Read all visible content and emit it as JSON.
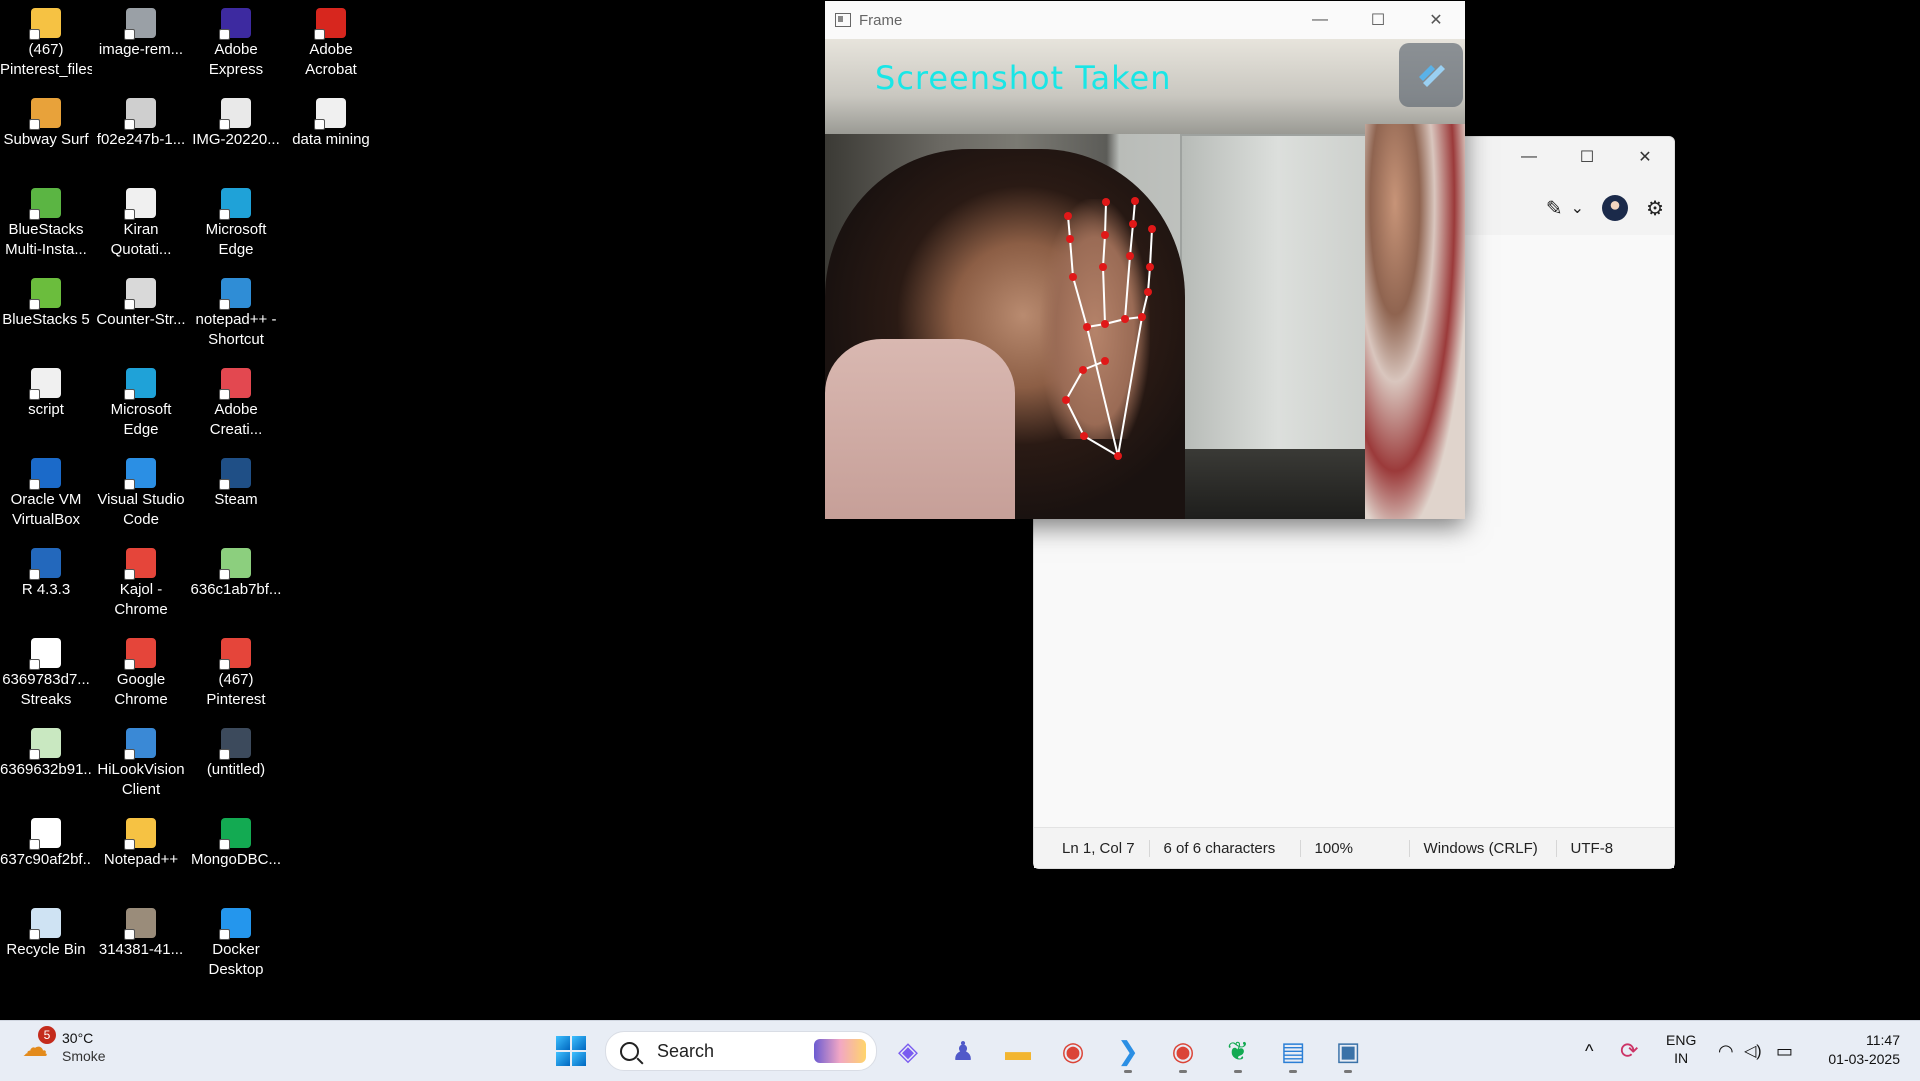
{
  "desktop": {
    "icons": [
      {
        "label": "(467)\nPinterest_files",
        "icon": "folder-icon",
        "color": "#f6c243"
      },
      {
        "label": "image-rem...",
        "icon": "python-file-icon",
        "color": "#9aa0a6"
      },
      {
        "label": "Adobe\nExpress",
        "icon": "adobe-express-icon",
        "color": "#3d2aa0"
      },
      {
        "label": "Adobe\nAcrobat",
        "icon": "adobe-acrobat-icon",
        "color": "#d7261e"
      },
      {
        "label": "Subway Surf",
        "icon": "subway-surf-icon",
        "color": "#e8a23a"
      },
      {
        "label": "f02e247b-1...",
        "icon": "image-file-icon",
        "color": "#cfcfcf"
      },
      {
        "label": "IMG-20220...",
        "icon": "image-file-icon",
        "color": "#e9e9e9"
      },
      {
        "label": "data mining",
        "icon": "document-icon",
        "color": "#f0f0f0"
      },
      {
        "label": "BlueStacks\nMulti-Insta...",
        "icon": "bluestacks-multi-icon",
        "color": "#5bb543"
      },
      {
        "label": "Kiran\nQuotati...",
        "icon": "document-icon",
        "color": "#f0f0f0"
      },
      {
        "label": "Microsoft\nEdge",
        "icon": "edge-icon",
        "color": "#1fa2d8"
      },
      {
        "label": "",
        "icon": "",
        "color": ""
      },
      {
        "label": "BlueStacks 5",
        "icon": "bluestacks-icon",
        "color": "#6bbd3d"
      },
      {
        "label": "Counter-Str...",
        "icon": "counter-strike-icon",
        "color": "#d9d9d9"
      },
      {
        "label": "notepad++ -\nShortcut",
        "icon": "notepadpp-shortcut-icon",
        "color": "#2f8dd6"
      },
      {
        "label": "",
        "icon": "",
        "color": ""
      },
      {
        "label": "script",
        "icon": "document-icon",
        "color": "#f0f0f0"
      },
      {
        "label": "Microsoft\nEdge",
        "icon": "edge-icon",
        "color": "#1fa2d8"
      },
      {
        "label": "Adobe\nCreati...",
        "icon": "adobe-creative-cloud-icon",
        "color": "#e34850"
      },
      {
        "label": "",
        "icon": "",
        "color": ""
      },
      {
        "label": "Oracle VM\nVirtualBox",
        "icon": "virtualbox-icon",
        "color": "#1b6ac9"
      },
      {
        "label": "Visual Studio\nCode",
        "icon": "vscode-icon",
        "color": "#2b8fe4"
      },
      {
        "label": "Steam",
        "icon": "steam-icon",
        "color": "#1f4f86"
      },
      {
        "label": "",
        "icon": "",
        "color": ""
      },
      {
        "label": "R 4.3.3",
        "icon": "r-icon",
        "color": "#2368bc"
      },
      {
        "label": "Kajol -\nChrome",
        "icon": "chrome-icon",
        "color": "#e5453a"
      },
      {
        "label": "636c1ab7bf...",
        "icon": "image-file-icon",
        "color": "#8ccf7e"
      },
      {
        "label": "",
        "icon": "",
        "color": ""
      },
      {
        "label": "6369783d7...\nStreaks",
        "icon": "image-file-icon",
        "color": "#ffffff"
      },
      {
        "label": "Google\nChrome",
        "icon": "chrome-icon",
        "color": "#e5453a"
      },
      {
        "label": "(467)\nPinterest",
        "icon": "chrome-html-icon",
        "color": "#e5453a"
      },
      {
        "label": "",
        "icon": "",
        "color": ""
      },
      {
        "label": "6369632b91...",
        "icon": "image-file-icon",
        "color": "#c9e8c1"
      },
      {
        "label": "HiLookVision\nClient",
        "icon": "hilookvision-icon",
        "color": "#3a89d6"
      },
      {
        "label": "(untitled)",
        "icon": "screen-file-icon",
        "color": "#3c4a5c"
      },
      {
        "label": "",
        "icon": "",
        "color": ""
      },
      {
        "label": "637c90af2bf...",
        "icon": "image-file-icon",
        "color": "#ffffff"
      },
      {
        "label": "Notepad++",
        "icon": "folder-icon",
        "color": "#f6c243"
      },
      {
        "label": "MongoDBC...",
        "icon": "mongodb-compass-icon",
        "color": "#13aa52"
      },
      {
        "label": "",
        "icon": "",
        "color": ""
      },
      {
        "label": "Recycle Bin",
        "icon": "recycle-bin-icon",
        "color": "#cfe3f3"
      },
      {
        "label": "314381-41...",
        "icon": "image-file-icon",
        "color": "#9a8c7a"
      },
      {
        "label": "Docker\nDesktop",
        "icon": "docker-icon",
        "color": "#2496ed"
      },
      {
        "label": "",
        "icon": "",
        "color": ""
      }
    ]
  },
  "notepad": {
    "controls": {
      "minimize": "—",
      "maximize": "☐",
      "close": "✕"
    },
    "toolbar": {
      "copilot": "✎",
      "chevron": "⌄",
      "settings": "⚙"
    },
    "status": {
      "position": "Ln 1, Col 7",
      "chars": "6 of 6 characters",
      "zoom": "100%",
      "line_endings": "Windows (CRLF)",
      "encoding": "UTF-8"
    }
  },
  "frame": {
    "title": "Frame",
    "controls": {
      "minimize": "—",
      "maximize": "☐",
      "close": "✕"
    },
    "overlay_text": "Screenshot Taken",
    "overlay_color": "#19e6e6",
    "landmark_color": "#e01818"
  },
  "taskbar": {
    "weather": {
      "badge": "5",
      "temp": "30°C",
      "condition": "Smoke"
    },
    "search_placeholder": "Search",
    "apps": [
      {
        "name": "copilot-icon",
        "glyph": "◈",
        "color": "#7a5cf0"
      },
      {
        "name": "teams-icon",
        "glyph": "♟",
        "color": "#5059c9"
      },
      {
        "name": "file-explorer-icon",
        "glyph": "▬",
        "color": "#f2b530"
      },
      {
        "name": "chrome-icon",
        "glyph": "◉",
        "color": "#db4437"
      },
      {
        "name": "vscode-icon",
        "glyph": "❯",
        "color": "#2b8fe4"
      },
      {
        "name": "chrome-profile-icon",
        "glyph": "◉",
        "color": "#db4437"
      },
      {
        "name": "mongodb-compass-icon",
        "glyph": "❦",
        "color": "#13aa52"
      },
      {
        "name": "notepad-icon",
        "glyph": "▤",
        "color": "#2b7fd6"
      },
      {
        "name": "python-icon",
        "glyph": "▣",
        "color": "#3a72a8"
      }
    ],
    "tray": {
      "chevron": "^",
      "sync": "⟳",
      "lang_line1": "ENG",
      "lang_line2": "IN",
      "wifi": "◠",
      "volume": "◁)",
      "battery": "▭"
    },
    "clock": {
      "time": "11:47",
      "date": "01-03-2025"
    }
  }
}
